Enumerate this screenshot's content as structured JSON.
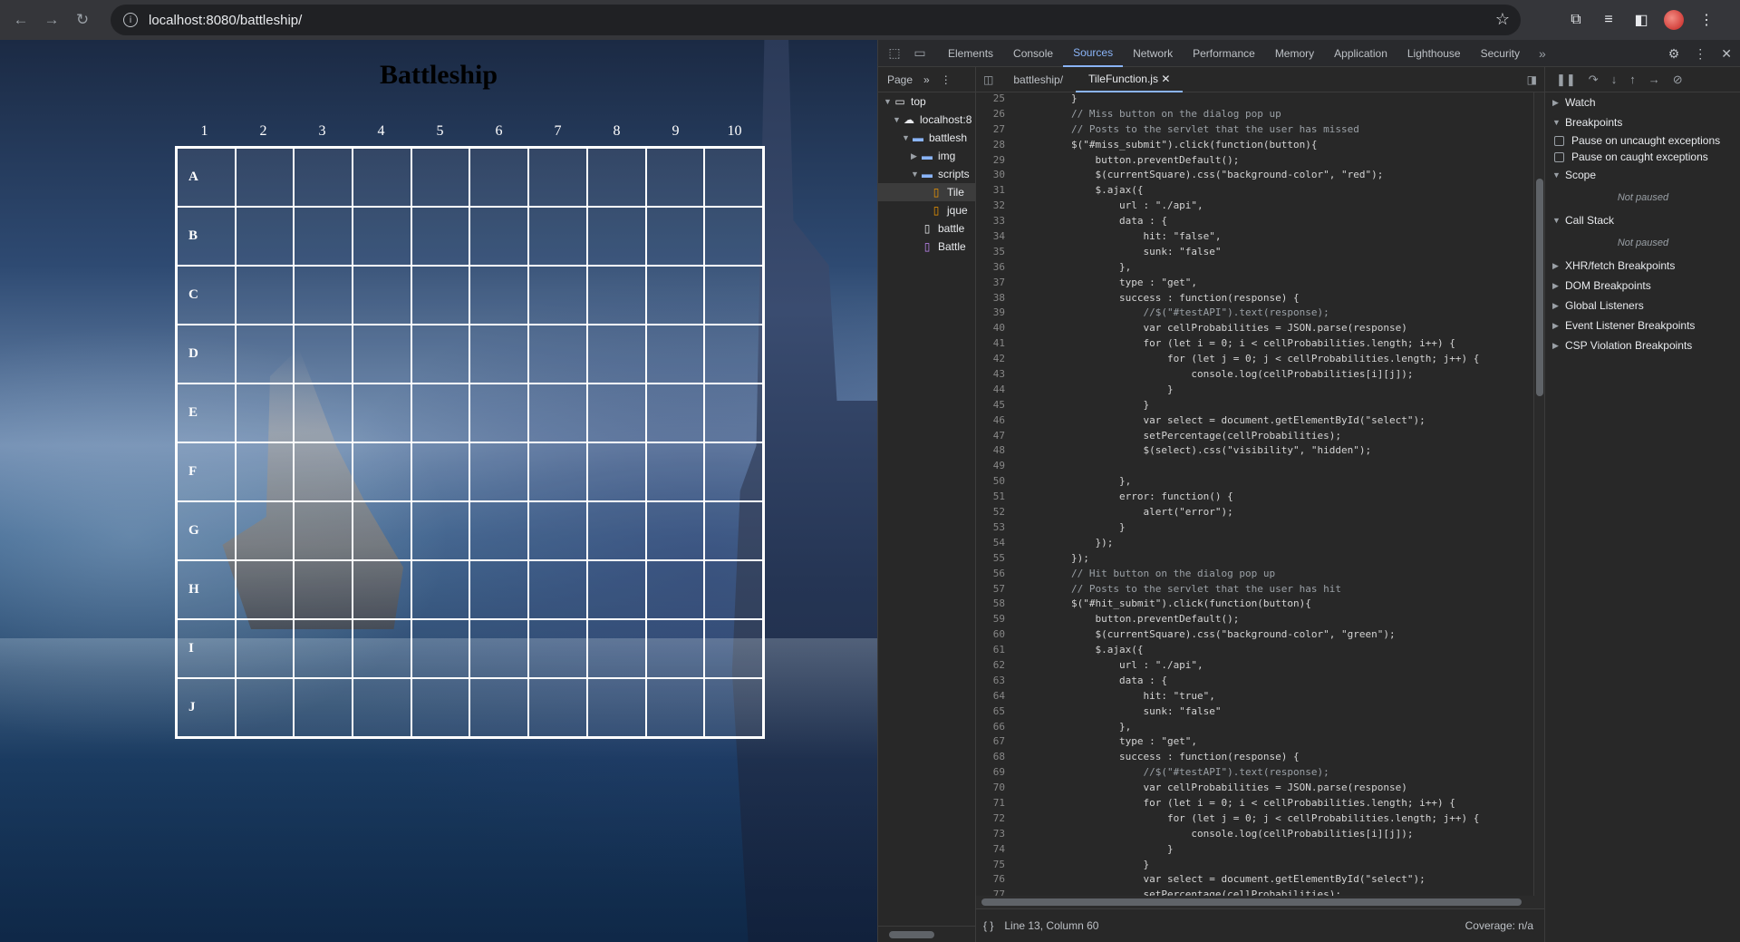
{
  "browser": {
    "url": "localhost:8080/battleship/",
    "nav": {
      "back": "←",
      "forward": "→",
      "reload": "↻"
    },
    "star_icon": "☆"
  },
  "page": {
    "title": "Battleship",
    "columns": [
      "1",
      "2",
      "3",
      "4",
      "5",
      "6",
      "7",
      "8",
      "9",
      "10"
    ],
    "rows": [
      "A",
      "B",
      "C",
      "D",
      "E",
      "F",
      "G",
      "H",
      "I",
      "J"
    ]
  },
  "devtools": {
    "tabs": [
      "Elements",
      "Console",
      "Sources",
      "Network",
      "Performance",
      "Memory",
      "Application",
      "Lighthouse",
      "Security"
    ],
    "active_tab": "Sources",
    "navigator": {
      "head": "Page",
      "tree": [
        {
          "label": "top",
          "depth": 0,
          "icon": "window-icon",
          "arrow": "▼"
        },
        {
          "label": "localhost:8",
          "depth": 1,
          "icon": "cloud-icon",
          "arrow": "▼"
        },
        {
          "label": "battlesh",
          "depth": 2,
          "icon": "folder-icon",
          "arrow": "▼"
        },
        {
          "label": "img",
          "depth": 3,
          "icon": "folder-icon",
          "arrow": "▶"
        },
        {
          "label": "scripts",
          "depth": 3,
          "icon": "folder-icon",
          "arrow": "▼"
        },
        {
          "label": "Tile",
          "depth": 4,
          "icon": "js-file-icon",
          "arrow": ""
        },
        {
          "label": "jque",
          "depth": 4,
          "icon": "js-file-icon",
          "arrow": ""
        },
        {
          "label": "battle",
          "depth": 3,
          "icon": "file-icon",
          "arrow": ""
        },
        {
          "label": "Battle",
          "depth": 3,
          "icon": "html-file-icon",
          "arrow": ""
        }
      ]
    },
    "editor_tabs": [
      "battleship/",
      "TileFunction.js"
    ],
    "code_lines": [
      {
        "n": "25",
        "t": "        }"
      },
      {
        "n": "26",
        "t": "        // Miss button on the dialog pop up"
      },
      {
        "n": "27",
        "t": "        // Posts to the servlet that the user has missed"
      },
      {
        "n": "28",
        "t": "        $(\"#miss_submit\").click(function(button){"
      },
      {
        "n": "29",
        "t": "            button.preventDefault();"
      },
      {
        "n": "30",
        "t": "            $(currentSquare).css(\"background-color\", \"red\");"
      },
      {
        "n": "31",
        "t": "            $.ajax({"
      },
      {
        "n": "32",
        "t": "                url : \"./api\","
      },
      {
        "n": "33",
        "t": "                data : {"
      },
      {
        "n": "34",
        "t": "                    hit: \"false\","
      },
      {
        "n": "35",
        "t": "                    sunk: \"false\""
      },
      {
        "n": "36",
        "t": "                },"
      },
      {
        "n": "37",
        "t": "                type : \"get\","
      },
      {
        "n": "38",
        "t": "                success : function(response) {"
      },
      {
        "n": "39",
        "t": "                    //$(\"#testAPI\").text(response);"
      },
      {
        "n": "40",
        "t": "                    var cellProbabilities = JSON.parse(response)"
      },
      {
        "n": "41",
        "t": "                    for (let i = 0; i < cellProbabilities.length; i++) {"
      },
      {
        "n": "42",
        "t": "                        for (let j = 0; j < cellProbabilities.length; j++) {"
      },
      {
        "n": "43",
        "t": "                            console.log(cellProbabilities[i][j]);"
      },
      {
        "n": "44",
        "t": "                        }"
      },
      {
        "n": "45",
        "t": "                    }"
      },
      {
        "n": "46",
        "t": "                    var select = document.getElementById(\"select\");"
      },
      {
        "n": "47",
        "t": "                    setPercentage(cellProbabilities);"
      },
      {
        "n": "48",
        "t": "                    $(select).css(\"visibility\", \"hidden\");"
      },
      {
        "n": "49",
        "t": ""
      },
      {
        "n": "50",
        "t": "                },"
      },
      {
        "n": "51",
        "t": "                error: function() {"
      },
      {
        "n": "52",
        "t": "                    alert(\"error\");"
      },
      {
        "n": "53",
        "t": "                }"
      },
      {
        "n": "54",
        "t": "            });"
      },
      {
        "n": "55",
        "t": "        });"
      },
      {
        "n": "56",
        "t": "        // Hit button on the dialog pop up"
      },
      {
        "n": "57",
        "t": "        // Posts to the servlet that the user has hit"
      },
      {
        "n": "58",
        "t": "        $(\"#hit_submit\").click(function(button){"
      },
      {
        "n": "59",
        "t": "            button.preventDefault();"
      },
      {
        "n": "60",
        "t": "            $(currentSquare).css(\"background-color\", \"green\");"
      },
      {
        "n": "61",
        "t": "            $.ajax({"
      },
      {
        "n": "62",
        "t": "                url : \"./api\","
      },
      {
        "n": "63",
        "t": "                data : {"
      },
      {
        "n": "64",
        "t": "                    hit: \"true\","
      },
      {
        "n": "65",
        "t": "                    sunk: \"false\""
      },
      {
        "n": "66",
        "t": "                },"
      },
      {
        "n": "67",
        "t": "                type : \"get\","
      },
      {
        "n": "68",
        "t": "                success : function(response) {"
      },
      {
        "n": "69",
        "t": "                    //$(\"#testAPI\").text(response);"
      },
      {
        "n": "70",
        "t": "                    var cellProbabilities = JSON.parse(response)"
      },
      {
        "n": "71",
        "t": "                    for (let i = 0; i < cellProbabilities.length; i++) {"
      },
      {
        "n": "72",
        "t": "                        for (let j = 0; j < cellProbabilities.length; j++) {"
      },
      {
        "n": "73",
        "t": "                            console.log(cellProbabilities[i][j]);"
      },
      {
        "n": "74",
        "t": "                        }"
      },
      {
        "n": "75",
        "t": "                    }"
      },
      {
        "n": "76",
        "t": "                    var select = document.getElementById(\"select\");"
      },
      {
        "n": "77",
        "t": "                    setPercentage(cellProbabilities);"
      }
    ],
    "status": {
      "position": "Line 13, Column 60",
      "coverage": "Coverage: n/a"
    },
    "debugger": {
      "watch": "Watch",
      "breakpoints": "Breakpoints",
      "pause_uncaught": "Pause on uncaught exceptions",
      "pause_caught": "Pause on caught exceptions",
      "scope": "Scope",
      "scope_state": "Not paused",
      "call_stack": "Call Stack",
      "call_stack_state": "Not paused",
      "collapsed": [
        "XHR/fetch Breakpoints",
        "DOM Breakpoints",
        "Global Listeners",
        "Event Listener Breakpoints",
        "CSP Violation Breakpoints"
      ]
    }
  }
}
